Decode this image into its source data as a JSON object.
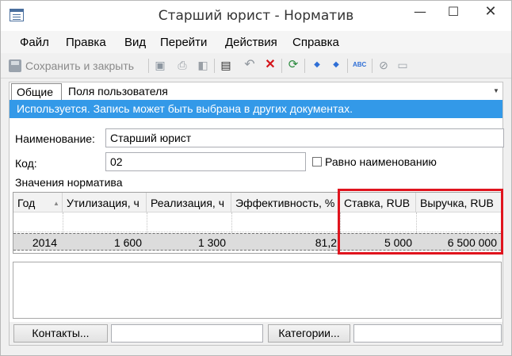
{
  "window": {
    "title": "Старший юрист - Норматив",
    "minimize": "—",
    "maximize": "☐",
    "close": "✕"
  },
  "menu": {
    "file": "Файл",
    "edit": "Правка",
    "view": "Вид",
    "go": "Перейти",
    "actions": "Действия",
    "help": "Справка"
  },
  "toolbar": {
    "save_close": "Сохранить и закрыть",
    "icons": [
      "save-icon",
      "print-icon",
      "preview-icon",
      "properties-icon",
      "undo-icon",
      "delete-icon",
      "refresh-icon",
      "arrow-up-icon",
      "arrow-down-icon",
      "spellcheck-icon",
      "attach-icon",
      "note-icon"
    ]
  },
  "tabs": {
    "general": "Общие",
    "user_fields": "Поля пользователя"
  },
  "info_bar": "Используется. Запись может быть выбрана в других документах.",
  "form": {
    "name_label": "Наименование:",
    "name_value": "Старший юрист",
    "code_label": "Код:",
    "code_value": "02",
    "same_as_name": "Равно наименованию",
    "same_as_name_checked": false,
    "values_label": "Значения норматива"
  },
  "grid": {
    "columns": [
      "Год",
      "Утилизация, ч",
      "Реализация, ч",
      "Эффективность, %",
      "Ставка, RUB",
      "Выручка, RUB"
    ],
    "rows": [
      [
        "2014",
        "1 600",
        "1 300",
        "81,2",
        "5 000",
        "6 500 000"
      ]
    ]
  },
  "bottom": {
    "contacts": "Контакты...",
    "contacts_value": "",
    "categories": "Категории...",
    "categories_value": ""
  },
  "colors": {
    "info_bar": "#3399e8",
    "highlight": "#e0141e",
    "selected_row": "#dcdcdc"
  }
}
